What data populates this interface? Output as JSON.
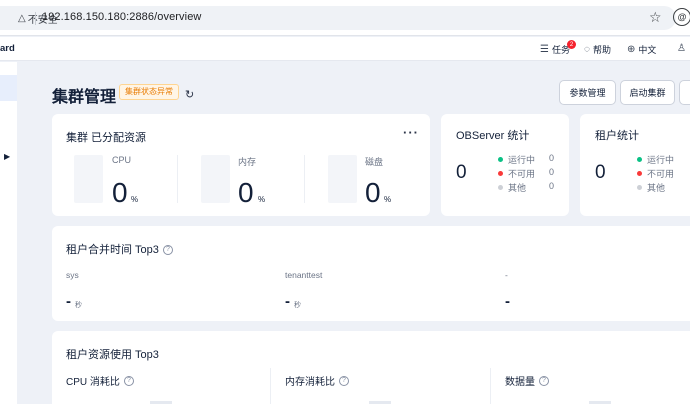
{
  "browser": {
    "security_label": "不安全",
    "url": "192.168.150.180:2886/overview"
  },
  "header": {
    "brand": "ard",
    "tasks_label": "任务",
    "tasks_count": "2",
    "help_label": "帮助",
    "lang_label": "中文"
  },
  "page": {
    "title": "集群管理",
    "status_tag": "集群状态异常",
    "buttons": [
      "参数管理",
      "启动集群"
    ]
  },
  "resources": {
    "title": "集群 已分配资源",
    "items": [
      {
        "label": "CPU",
        "value": "0",
        "unit": "%"
      },
      {
        "label": "内存",
        "value": "0",
        "unit": "%"
      },
      {
        "label": "磁盘",
        "value": "0",
        "unit": "%"
      }
    ]
  },
  "observer": {
    "title": "OBServer 统计",
    "total": "0",
    "legend": [
      {
        "label": "运行中",
        "value": "0",
        "color": "#0ac185"
      },
      {
        "label": "不可用",
        "value": "0",
        "color": "#f93939"
      },
      {
        "label": "其他",
        "value": "0",
        "color": "#cdd0d6"
      }
    ]
  },
  "tenants": {
    "title": "租户统计",
    "total": "0",
    "legend": [
      {
        "label": "运行中",
        "color": "#0ac185"
      },
      {
        "label": "不可用",
        "color": "#f93939"
      },
      {
        "label": "其他",
        "color": "#cdd0d6"
      }
    ]
  },
  "merge": {
    "title": "租户合并时间 Top3",
    "items": [
      {
        "name": "sys",
        "value": "-",
        "unit": "秒"
      },
      {
        "name": "tenanttest",
        "value": "-",
        "unit": "秒"
      },
      {
        "name": "-",
        "value": "-",
        "unit": ""
      }
    ]
  },
  "usage": {
    "title": "租户资源使用 Top3",
    "metrics": [
      "CPU 消耗比",
      "内存消耗比",
      "数据量"
    ]
  }
}
